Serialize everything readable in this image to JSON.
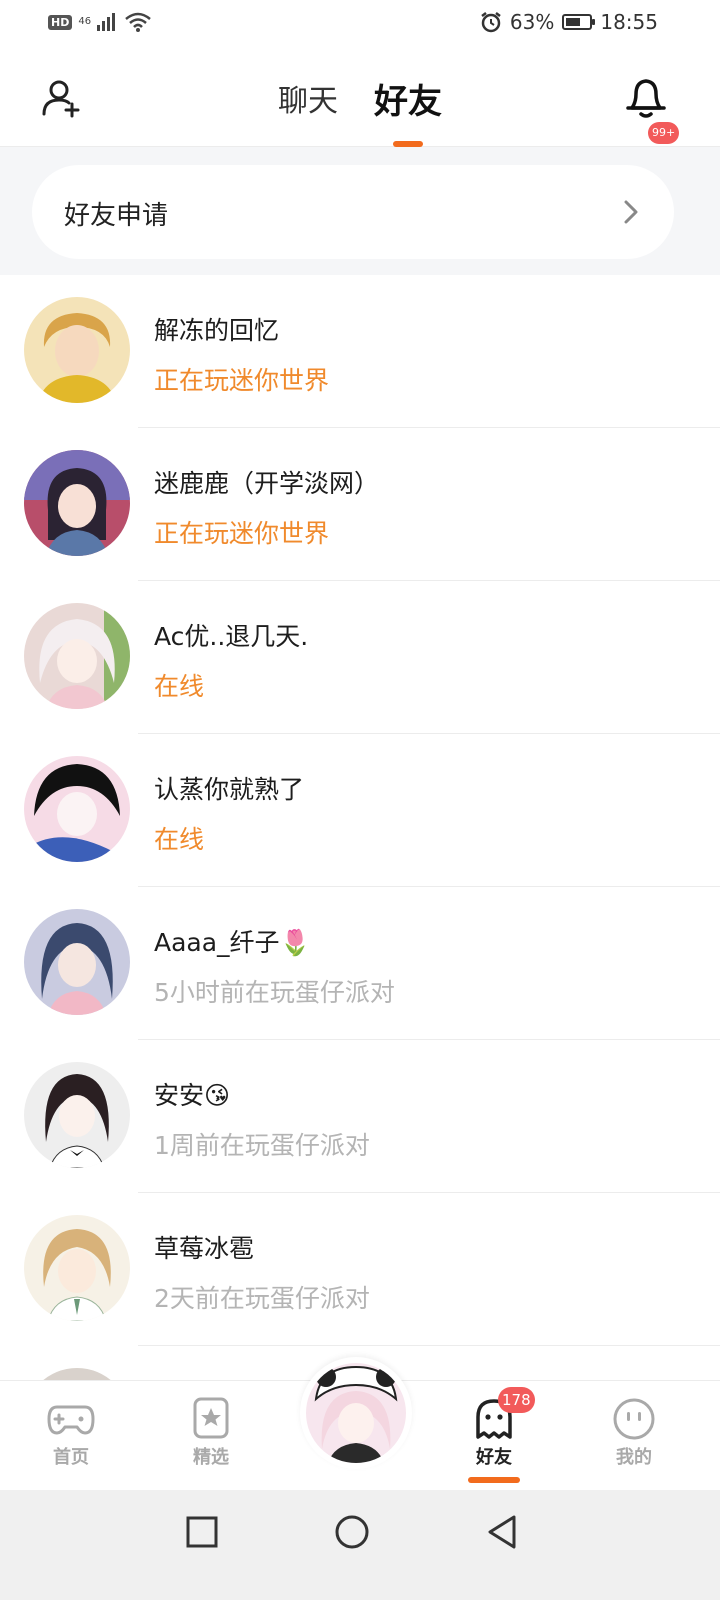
{
  "status_bar": {
    "hd": "HD",
    "network": "46",
    "alarm_icon": "alarm-icon",
    "battery_percent": "63%",
    "battery_level": 0.63,
    "time": "18:55"
  },
  "header": {
    "tabs": [
      {
        "label": "聊天",
        "active": false
      },
      {
        "label": "好友",
        "active": true
      }
    ],
    "notification_badge": "99+",
    "accent_color": "#f26b1d"
  },
  "friend_request": {
    "label": "好友申请"
  },
  "friends": [
    {
      "name": "解冻的回忆",
      "status": "正在玩迷你世界",
      "online": true
    },
    {
      "name": "迷鹿鹿（开学淡网）",
      "status": "正在玩迷你世界",
      "online": true
    },
    {
      "name": "Ac优..退几天.",
      "status": "在线",
      "online": true
    },
    {
      "name": "认蒸你就熟了",
      "status": "在线",
      "online": true
    },
    {
      "name": "Aaaa_纤子🌷",
      "status": "5小时前在玩蛋仔派对",
      "online": false
    },
    {
      "name": "安安😘",
      "status": "1周前在玩蛋仔派对",
      "online": false
    },
    {
      "name": "草莓冰雹",
      "status": "2天前在玩蛋仔派对",
      "online": false
    }
  ],
  "bottom_nav": {
    "items": [
      {
        "label": "首页",
        "icon": "gamepad-icon"
      },
      {
        "label": "精选",
        "icon": "star-bookmark-icon"
      },
      {
        "label": "好友",
        "icon": "ghost-icon",
        "badge": "178",
        "active": true
      },
      {
        "label": "我的",
        "icon": "face-icon"
      }
    ]
  }
}
